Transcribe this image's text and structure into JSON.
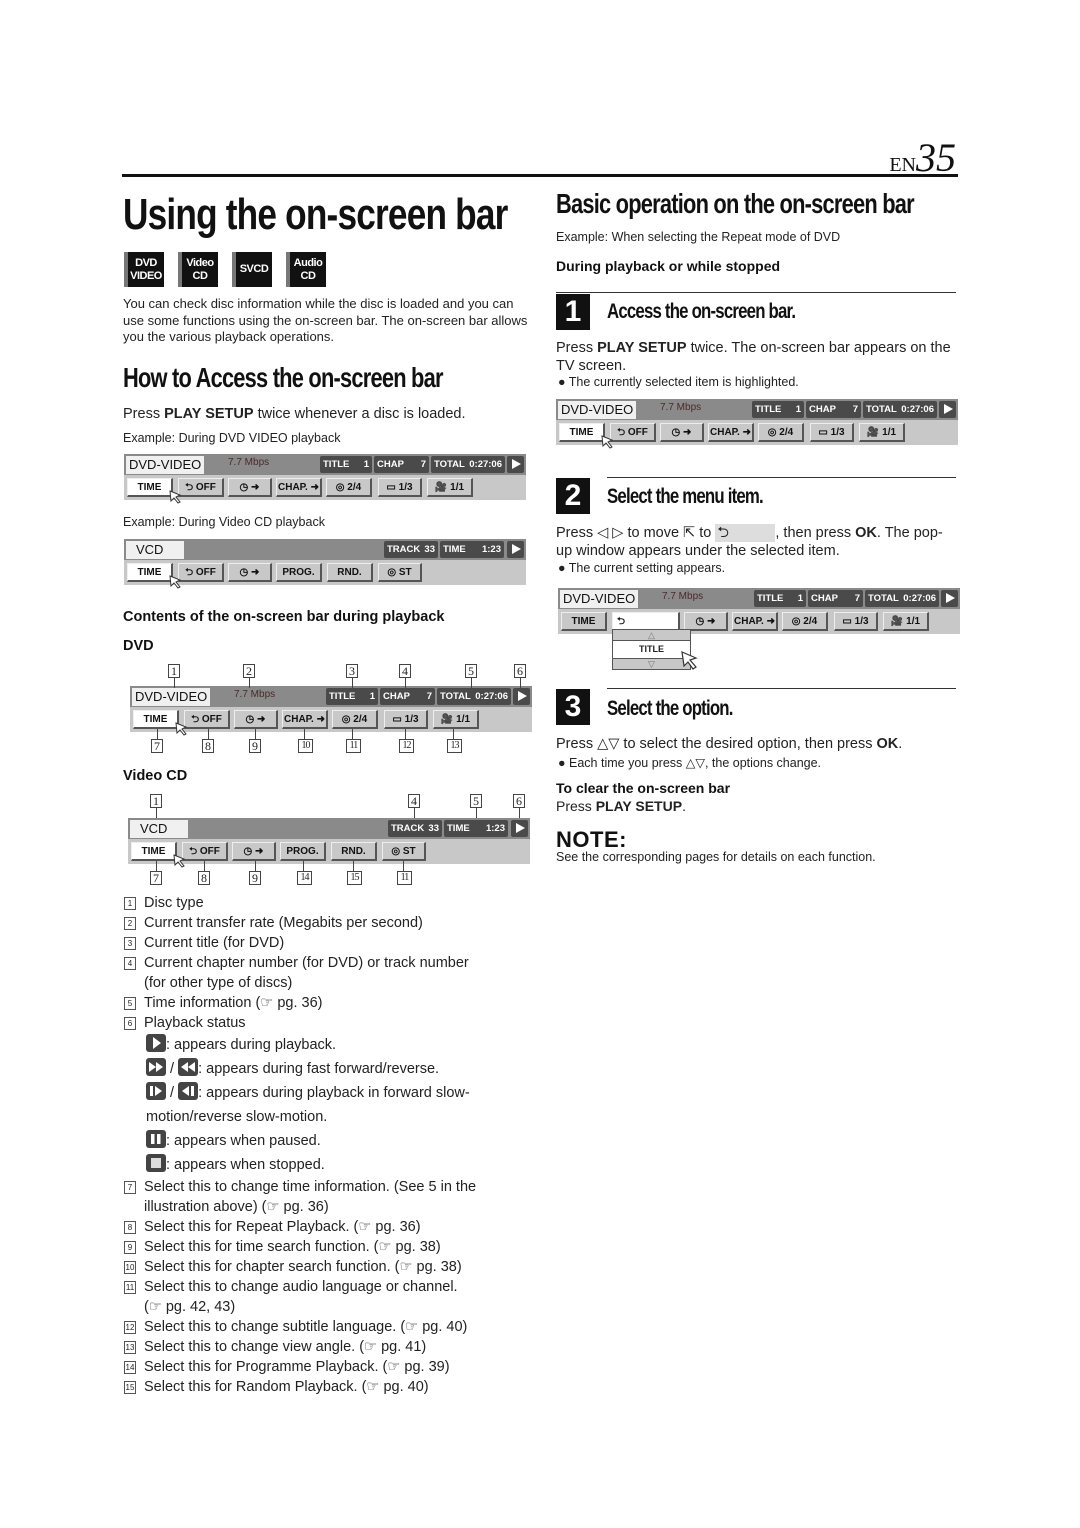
{
  "header": {
    "lang": "EN",
    "page": "35"
  },
  "left": {
    "title": "Using the on-screen bar",
    "badges": [
      [
        "DVD",
        "VIDEO"
      ],
      [
        "Video",
        "CD"
      ],
      [
        "SVCD"
      ],
      [
        "Audio",
        "CD"
      ]
    ],
    "intro": "You can check disc information while the disc is loaded and you can use some functions using the on-screen bar. The on-screen bar allows you the various playback operations.",
    "how_heading": "How to Access the on-screen bar",
    "how_press_pre": "Press ",
    "how_press_key": "PLAY SETUP",
    "how_press_post": " twice whenever a disc is loaded.",
    "example_dvd": "Example: During DVD VIDEO playback",
    "example_vcd": "Example: During Video CD playback",
    "contents_heading": "Contents of the on-screen bar during playback",
    "dvd_label": "DVD",
    "vcd_label": "Video CD",
    "legend": [
      {
        "k": "1",
        "t": "Disc type"
      },
      {
        "k": "2",
        "t": "Current transfer rate (Megabits per second)"
      },
      {
        "k": "3",
        "t": "Current title (for DVD)"
      },
      {
        "k": "4",
        "t": "Current chapter number (for DVD) or track number"
      },
      {
        "k": "",
        "t": "(for other type of discs)"
      },
      {
        "k": "5",
        "t": "Time information (☞ pg. 36)"
      },
      {
        "k": "6",
        "t": "Playback status"
      }
    ],
    "status_items": [
      ": appears during playback.",
      ": appears during fast forward/reverse.",
      ": appears during playback in forward slow-",
      "motion/reverse slow-motion.",
      ": appears when paused.",
      ": appears when stopped."
    ],
    "legend2": [
      {
        "k": "7",
        "t": "Select this to change time information. (See 5 in the"
      },
      {
        "k": "",
        "t": "illustration above) (☞ pg. 36)"
      },
      {
        "k": "8",
        "t": "Select this for Repeat Playback. (☞ pg. 36)"
      },
      {
        "k": "9",
        "t": "Select this for time search function. (☞ pg. 38)"
      },
      {
        "k": "10",
        "t": "Select this for chapter search function. (☞ pg. 38)"
      },
      {
        "k": "11",
        "t": "Select this to change audio language or channel."
      },
      {
        "k": "",
        "t": "(☞ pg. 42, 43)"
      },
      {
        "k": "12",
        "t": "Select this to change subtitle language. (☞ pg. 40)"
      },
      {
        "k": "13",
        "t": "Select this to change view angle. (☞ pg. 41)"
      },
      {
        "k": "14",
        "t": "Select this for Programme Playback. (☞ pg. 39)"
      },
      {
        "k": "15",
        "t": "Select this for Random Playback. (☞ pg. 40)"
      }
    ]
  },
  "bars": {
    "dvd": {
      "disc": "DVD-VIDEO",
      "rate": "7.7 Mbps",
      "title_label": "TITLE",
      "title_val": "1",
      "chap_label": "CHAP",
      "chap_val": "7",
      "total_label": "TOTAL",
      "total_val": "0:27:06",
      "buttons": [
        "TIME",
        "⮌ OFF",
        "◷ ➜",
        "CHAP. ➜",
        "◎ 2/4",
        "▭ 1/3",
        "🎥 1/1"
      ]
    },
    "vcd": {
      "disc": "VCD",
      "track_label": "TRACK",
      "track_val": "33",
      "time_label": "TIME",
      "time_val": "1:23",
      "buttons": [
        "TIME",
        "⮌ OFF",
        "◷ ➜",
        "PROG.",
        "RND.",
        "◎ ST"
      ]
    }
  },
  "callouts": {
    "dvd_top": [
      "1",
      "2",
      "3",
      "4",
      "5",
      "6"
    ],
    "dvd_bottom": [
      "7",
      "8",
      "9",
      "10",
      "11",
      "12",
      "13"
    ],
    "vcd_top": [
      "1",
      "4",
      "5",
      "6"
    ],
    "vcd_bottom": [
      "7",
      "8",
      "9",
      "14",
      "15",
      "11"
    ]
  },
  "right": {
    "heading": "Basic operation on the on-screen bar",
    "example": "Example: When selecting the Repeat mode of DVD",
    "during": "During playback or while stopped",
    "steps": [
      {
        "n": "1",
        "title": "Access the on-screen bar."
      },
      {
        "n": "2",
        "title": "Select the menu item."
      },
      {
        "n": "3",
        "title": "Select the option."
      }
    ],
    "step1_pre": "Press ",
    "step1_key": "PLAY SETUP",
    "step1_post": " twice. The on-screen bar appears on the TV screen.",
    "step1_bullet": "● The currently selected item is highlighted.",
    "step2_a": "Press ◁ ▷ to move ⇱ to ",
    "step2_icon": "⮌",
    "step2_b": ", then press ",
    "step2_key": "OK",
    "step2_c": ". The pop-up window appears under the selected item.",
    "step2_bullet": "● The current setting appears.",
    "popup_value": "TITLE",
    "step3_a": "Press △▽ to select the desired option, then press ",
    "step3_key": "OK",
    "step3_b": ".",
    "step3_bullet": "● Each time you press △▽, the options change.",
    "clear_heading": "To clear the on-screen bar",
    "clear_pre": "Press ",
    "clear_key": "PLAY SETUP",
    "clear_post": ".",
    "note_heading": "NOTE:",
    "note_text": "See the corresponding pages for details on each function."
  }
}
